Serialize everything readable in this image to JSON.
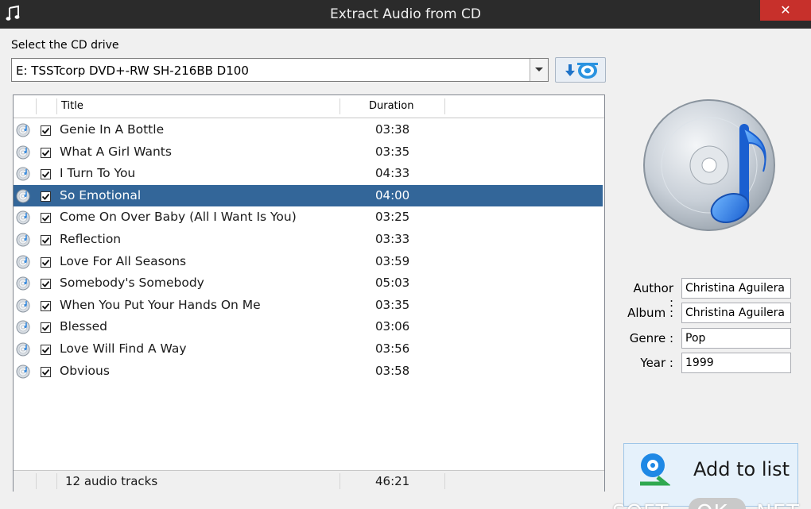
{
  "window": {
    "title": "Extract Audio from CD",
    "close_glyph": "✕"
  },
  "drive": {
    "label": "Select the CD drive",
    "value": "E: TSSTcorp DVD+-RW SH-216BB D100"
  },
  "list": {
    "columns": {
      "title": "Title",
      "duration": "Duration"
    },
    "tracks": [
      {
        "title": "Genie In A Bottle",
        "duration": "03:38"
      },
      {
        "title": "What A Girl Wants",
        "duration": "03:35"
      },
      {
        "title": "I Turn To You",
        "duration": "04:33"
      },
      {
        "title": "So Emotional",
        "duration": "04:00"
      },
      {
        "title": "Come On Over Baby (All I Want Is You)",
        "duration": "03:25"
      },
      {
        "title": "Reflection",
        "duration": "03:33"
      },
      {
        "title": "Love For All Seasons",
        "duration": "03:59"
      },
      {
        "title": "Somebody's Somebody",
        "duration": "05:03"
      },
      {
        "title": "When You Put Your Hands On Me",
        "duration": "03:35"
      },
      {
        "title": "Blessed",
        "duration": "03:06"
      },
      {
        "title": "Love Will Find A Way",
        "duration": "03:56"
      },
      {
        "title": "Obvious",
        "duration": "03:58"
      }
    ],
    "selected_index": 3,
    "footer": {
      "count": "12 audio tracks",
      "total": "46:21"
    }
  },
  "meta": {
    "author_label": "Author :",
    "author": "Christina Aguilera",
    "album_label": "Album :",
    "album": "Christina Aguilera",
    "genre_label": "Genre :",
    "genre": "Pop",
    "year_label": "Year :",
    "year": "1999"
  },
  "add_button": {
    "label": "Add to list"
  },
  "watermark": {
    "part1": "SOFT-",
    "part2": "OK",
    "part3": ".NET"
  },
  "colors": {
    "selection": "#336699",
    "titlebar": "#2b2b2b",
    "close": "#c7302b",
    "accent": "#1e88e5"
  },
  "icons": [
    "music-note-icon",
    "close-icon",
    "dropdown-arrow-icon",
    "eject-disc-icon",
    "cd-track-icon",
    "checkbox-icon",
    "cd-music-art-icon",
    "add-list-icon"
  ]
}
